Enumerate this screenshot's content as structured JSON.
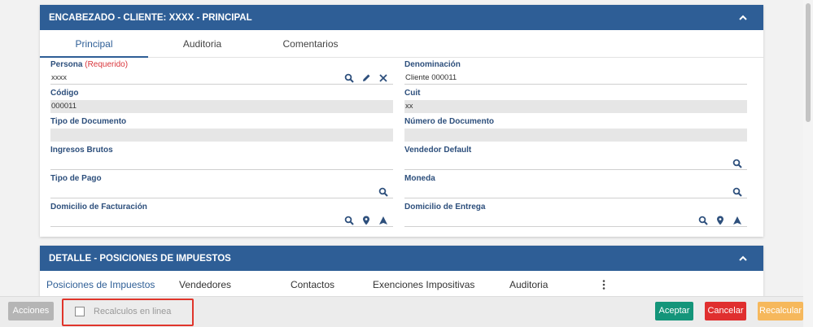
{
  "header_panel": {
    "title": "ENCABEZADO - CLIENTE: XXXX - PRINCIPAL",
    "tabs": [
      {
        "label": "Principal",
        "active": true
      },
      {
        "label": "Auditoria"
      },
      {
        "label": "Comentarios"
      }
    ],
    "fields": {
      "persona": {
        "label": "Persona",
        "required": "(Requerido)",
        "value": "xxxx"
      },
      "denominacion": {
        "label": "Denominación",
        "value": "Cliente 000011"
      },
      "codigo": {
        "label": "Código",
        "value": "000011"
      },
      "cuit": {
        "label": "Cuit",
        "value": "xx"
      },
      "tipo_documento": {
        "label": "Tipo de Documento",
        "value": ""
      },
      "numero_documento": {
        "label": "Número de Documento",
        "value": ""
      },
      "ingresos_brutos": {
        "label": "Ingresos Brutos",
        "value": ""
      },
      "vendedor_default": {
        "label": "Vendedor Default",
        "value": ""
      },
      "tipo_pago": {
        "label": "Tipo de Pago",
        "value": ""
      },
      "moneda": {
        "label": "Moneda",
        "value": ""
      },
      "domicilio_facturacion": {
        "label": "Domicilio de Facturación",
        "value": ""
      },
      "domicilio_entrega": {
        "label": "Domicilio de Entrega",
        "value": ""
      }
    }
  },
  "detail_panel": {
    "title": "DETALLE - POSICIONES DE IMPUESTOS",
    "tabs": [
      {
        "label": "Posiciones de Impuestos",
        "active": true
      },
      {
        "label": "Vendedores"
      },
      {
        "label": "Contactos"
      },
      {
        "label": "Exenciones Impositivas"
      },
      {
        "label": "Auditoria"
      }
    ]
  },
  "footer": {
    "acciones": "Acciones",
    "recalculos_label": "Recalculos en linea",
    "recalculos_checked": false,
    "aceptar": "Aceptar",
    "cancelar": "Cancelar",
    "recalcular": "Recalcular"
  },
  "colors": {
    "header": "#2e5e96",
    "label": "#2d4f7c",
    "required": "#d9353b",
    "aceptar": "#14957a",
    "cancelar": "#e02f2f",
    "recalcular": "#f6b85c",
    "acciones": "#b5b5b5",
    "highlight": "#e0352b"
  }
}
